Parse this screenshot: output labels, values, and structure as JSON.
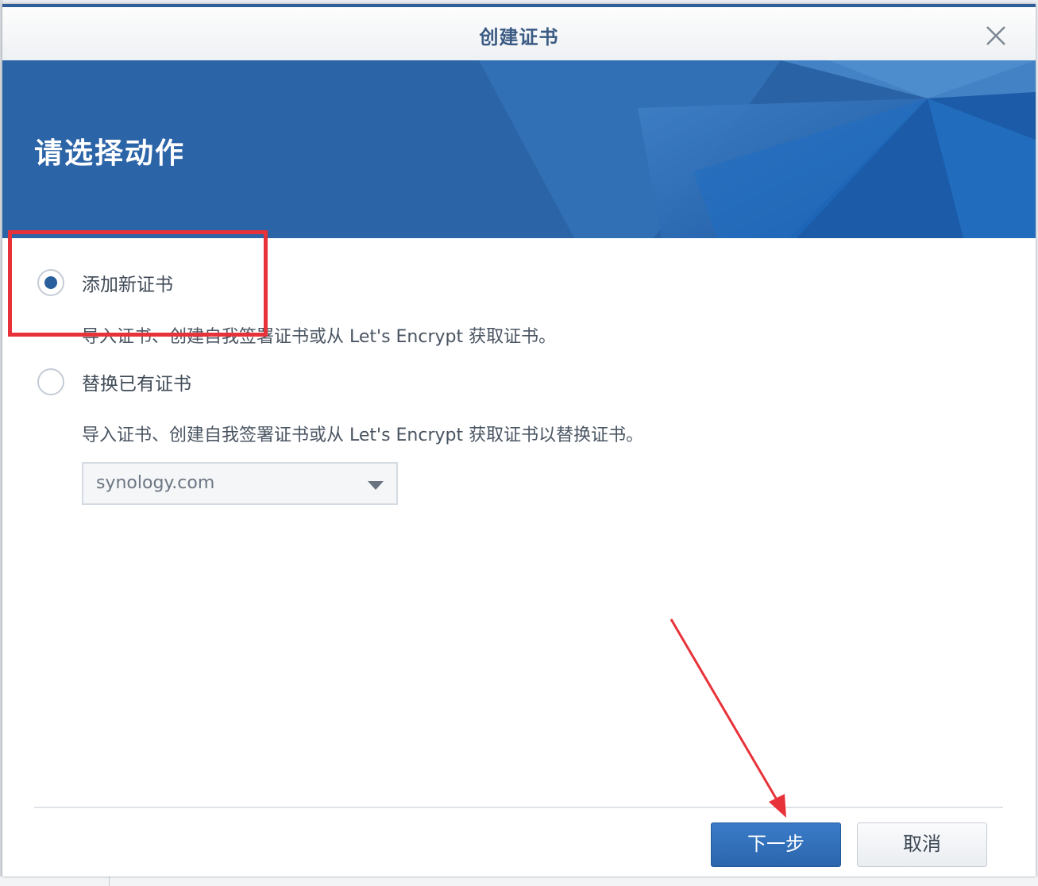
{
  "dialog": {
    "title": "创建证书",
    "banner_title": "请选择动作",
    "options": [
      {
        "label": "添加新证书",
        "description": "导入证书、创建自我签署证书或从 Let's Encrypt 获取证书。",
        "selected": true
      },
      {
        "label": "替换已有证书",
        "description": "导入证书、创建自我签署证书或从 Let's Encrypt 获取证书以替换证书。",
        "selected": false
      }
    ],
    "select_value": "synology.com",
    "buttons": {
      "next": "下一步",
      "cancel": "取消"
    }
  },
  "icons": {
    "close": "close-icon",
    "caret": "chevron-down-icon"
  },
  "colors": {
    "accent": "#2c64a8",
    "title_text": "#3b5b84",
    "primary_button": "#2f6fb8",
    "annotation_red": "#e8323a"
  }
}
